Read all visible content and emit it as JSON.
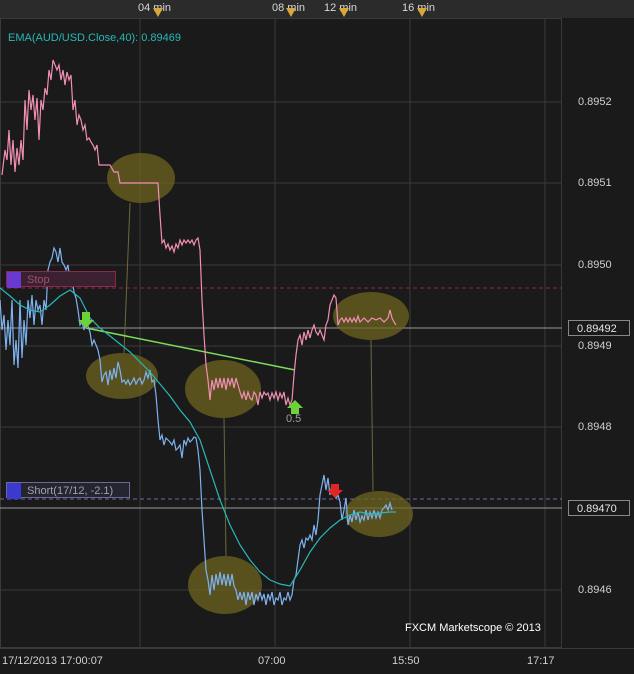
{
  "top_axis": {
    "labels": [
      "04 min",
      "08 min",
      "12 min",
      "16 min"
    ],
    "marker_color": "#d9a73a"
  },
  "indicator": {
    "label": "EMA(AUD/USD.Close,40): 0.89469",
    "color": "#27b9b9"
  },
  "price_axis": {
    "ticks": [
      "0.8952",
      "0.8951",
      "0.8950",
      "0.8949",
      "0.8948",
      "0.8946"
    ],
    "current_bid": "0.89492",
    "current_ask": "0.89470"
  },
  "time_axis": {
    "labels": [
      "17/12/2013 17:00:07",
      "07:00",
      "15:50",
      "17:17"
    ]
  },
  "orders": {
    "stop": {
      "label": "Stop",
      "color": "#8a2a4a"
    },
    "short": {
      "label": "Short(17/12, -2.1)",
      "color": "#3a3ad0"
    }
  },
  "annotation": {
    "value_label": "0.5"
  },
  "watermark": "FXCM Marketscope © 2013",
  "colors": {
    "bid_series": "#f28fb4",
    "ask_series": "#7fb2f0",
    "ema_series": "#27b9b9",
    "trend_line": "#7ddc5a",
    "highlight": "#9b8a2a",
    "arrow_up": "#6cd23a",
    "arrow_down": "#e22626"
  }
}
